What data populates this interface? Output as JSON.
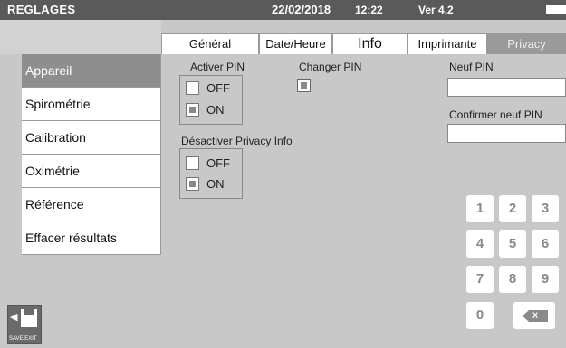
{
  "status": {
    "title": "REGLAGES",
    "date": "22/02/2018",
    "time": "12:22",
    "version": "Ver 4.2"
  },
  "tabs": [
    {
      "label": "Général"
    },
    {
      "label": "Date/Heure"
    },
    {
      "label": "Info"
    },
    {
      "label": "Imprimante"
    },
    {
      "label": "Privacy",
      "active": true
    }
  ],
  "sidebar": {
    "items": [
      {
        "label": "Appareil",
        "active": true
      },
      {
        "label": "Spirométrie"
      },
      {
        "label": "Calibration"
      },
      {
        "label": "Oximétrie"
      },
      {
        "label": "Référence"
      },
      {
        "label": "Effacer résultats"
      }
    ],
    "save_exit_label": "SAVE/EXIT"
  },
  "privacy": {
    "activer_pin": {
      "label": "Activer PIN",
      "off": "OFF",
      "on": "ON",
      "selected": "ON"
    },
    "changer_pin": {
      "label": "Changer PIN"
    },
    "neuf_pin": {
      "label": "Neuf PIN",
      "value": ""
    },
    "confirmer_pin": {
      "label": "Confirmer neuf  PIN",
      "value": ""
    },
    "desactiver_privacy": {
      "label": "Désactiver Privacy Info",
      "off": "OFF",
      "on": "ON",
      "selected": "ON"
    }
  },
  "keypad": {
    "keys": [
      "1",
      "2",
      "3",
      "4",
      "5",
      "6",
      "7",
      "8",
      "9",
      "0"
    ],
    "backspace": "X"
  }
}
